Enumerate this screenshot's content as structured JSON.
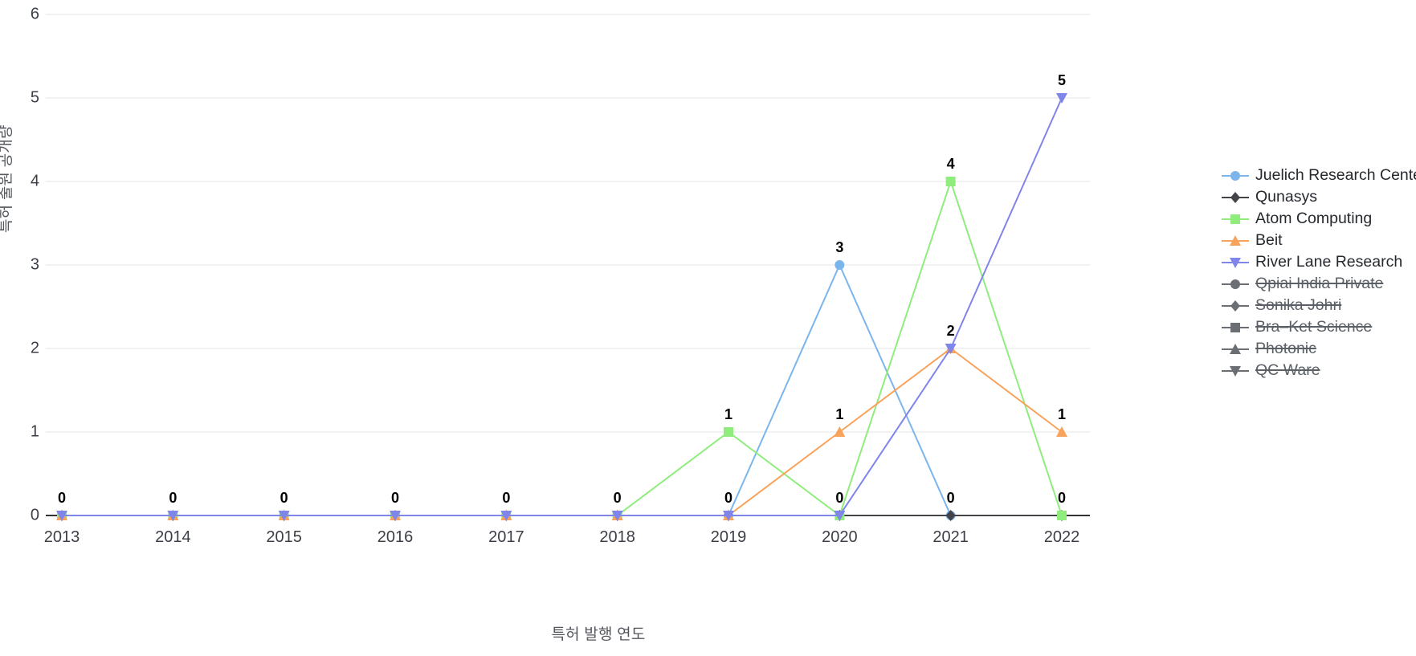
{
  "chart_data": {
    "type": "line",
    "title": "",
    "xlabel": "특허 발행 연도",
    "ylabel": "특허 출원 공개량",
    "categories": [
      "2013",
      "2014",
      "2015",
      "2016",
      "2017",
      "2018",
      "2019",
      "2020",
      "2021",
      "2022"
    ],
    "x": [
      2013,
      2014,
      2015,
      2016,
      2017,
      2018,
      2019,
      2020,
      2021,
      2022
    ],
    "ylim": [
      0,
      6
    ],
    "xlim": [
      2013,
      2022
    ],
    "yticks": [
      "0",
      "1",
      "2",
      "3",
      "4",
      "5",
      "6"
    ],
    "grid": "horizontal",
    "legend_position": "right",
    "point_labels_shown": true,
    "series": [
      {
        "name": "Juelich Research Center",
        "color": "#7cb5ec",
        "marker": "circle",
        "visible": true,
        "values": [
          0,
          0,
          0,
          0,
          0,
          0,
          0,
          3,
          0,
          0
        ]
      },
      {
        "name": "Qunasys",
        "color": "#434348",
        "marker": "diamond",
        "visible": true,
        "values": [
          0,
          0,
          0,
          0,
          0,
          0,
          0,
          0,
          0,
          0
        ]
      },
      {
        "name": "Atom Computing",
        "color": "#90ed7d",
        "marker": "square",
        "visible": true,
        "values": [
          0,
          0,
          0,
          0,
          0,
          0,
          1,
          0,
          4,
          0
        ]
      },
      {
        "name": "Beit",
        "color": "#f7a35c",
        "marker": "triangle",
        "visible": true,
        "values": [
          0,
          0,
          0,
          0,
          0,
          0,
          0,
          1,
          2,
          1
        ]
      },
      {
        "name": "River Lane Research",
        "color": "#8085e9",
        "marker": "triangle-down",
        "visible": true,
        "values": [
          0,
          0,
          0,
          0,
          0,
          0,
          0,
          0,
          2,
          5
        ]
      },
      {
        "name": "Qpiai India Private",
        "color": "#6b6f74",
        "marker": "circle",
        "visible": false,
        "values": [
          0,
          0,
          0,
          0,
          0,
          0,
          0,
          0,
          0,
          0
        ]
      },
      {
        "name": "Sonika Johri",
        "color": "#6b6f74",
        "marker": "diamond",
        "visible": false,
        "values": [
          0,
          0,
          0,
          0,
          0,
          0,
          0,
          0,
          0,
          0
        ]
      },
      {
        "name": "Bra–Ket Science",
        "color": "#6b6f74",
        "marker": "square",
        "visible": false,
        "values": [
          0,
          0,
          0,
          0,
          0,
          0,
          0,
          0,
          0,
          0
        ]
      },
      {
        "name": "Photonic",
        "color": "#6b6f74",
        "marker": "triangle",
        "visible": false,
        "values": [
          0,
          0,
          0,
          0,
          0,
          0,
          0,
          0,
          0,
          0
        ]
      },
      {
        "name": "QC Ware",
        "color": "#6b6f74",
        "marker": "triangle-down",
        "visible": false,
        "values": [
          0,
          0,
          0,
          0,
          0,
          0,
          0,
          0,
          0,
          0
        ]
      }
    ],
    "data_labels": [
      {
        "series": "Juelich Research Center",
        "x": "2020",
        "value": "3"
      },
      {
        "series": "Atom Computing",
        "x": "2019",
        "value": "1"
      },
      {
        "series": "Atom Computing",
        "x": "2021",
        "value": "4"
      },
      {
        "series": "Atom Computing",
        "x": "2022",
        "value": "0"
      },
      {
        "series": "Beit",
        "x": "2020",
        "value": "1"
      },
      {
        "series": "Beit",
        "x": "2021",
        "value": "2"
      },
      {
        "series": "Beit",
        "x": "2022",
        "value": "1"
      },
      {
        "series": "River Lane Research",
        "x": "2022",
        "value": "5"
      },
      {
        "series": "baseline",
        "x": "2013",
        "value": "0"
      },
      {
        "series": "baseline",
        "x": "2014",
        "value": "0"
      },
      {
        "series": "baseline",
        "x": "2015",
        "value": "0"
      },
      {
        "series": "baseline",
        "x": "2016",
        "value": "0"
      },
      {
        "series": "baseline",
        "x": "2017",
        "value": "0"
      },
      {
        "series": "baseline",
        "x": "2018",
        "value": "0"
      },
      {
        "series": "baseline",
        "x": "2019",
        "value": "0"
      },
      {
        "series": "baseline",
        "x": "2020",
        "value": "0"
      },
      {
        "series": "baseline",
        "x": "2021",
        "value": "0"
      }
    ]
  },
  "axes": {
    "y_title": "특허 출원 공개량",
    "x_title": "특허 발행 연도"
  },
  "colors": {
    "grid": "#e9e9e9",
    "axis": "#333333",
    "text": "#3b3f45",
    "muted_text": "#53575c",
    "disabled_legend": "#5b6066"
  }
}
